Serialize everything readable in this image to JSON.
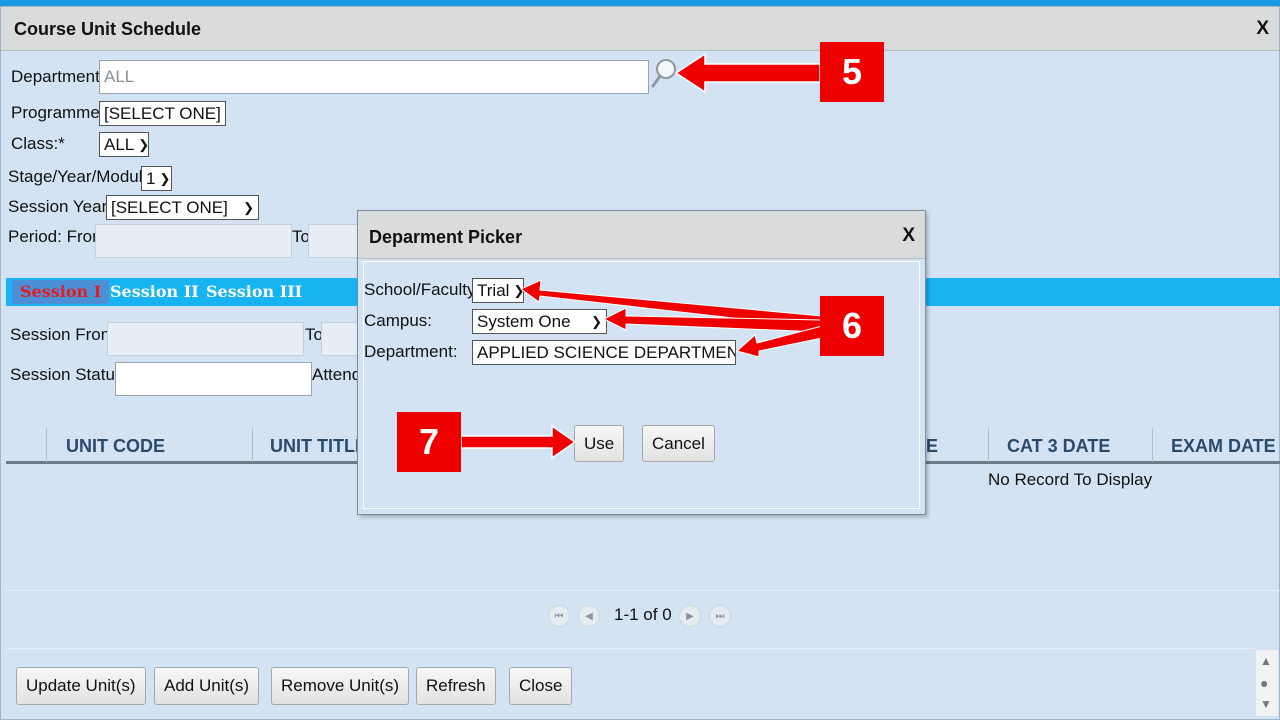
{
  "window": {
    "title": "Course Unit Schedule",
    "close": "X"
  },
  "form": {
    "department_label": "Department:",
    "department_value": "ALL",
    "programme_label": "Programme:",
    "programme_value": "[SELECT ONE]",
    "class_label": "Class:*",
    "class_value": "ALL",
    "stage_label": "Stage/Year/Module:",
    "stage_value": "1",
    "session_year_label": "Session Year:*",
    "session_year_value": "[SELECT ONE]",
    "period_from_label": "Period: From",
    "period_to_label": "To"
  },
  "tabs": [
    "Session I",
    "Session II",
    "Session III"
  ],
  "session": {
    "from_label": "Session From:",
    "to_label": "To",
    "status_label": "Session Status:",
    "attendance_label": "Attenda"
  },
  "grid": {
    "columns": [
      "UNIT CODE",
      "UNIT TITLE",
      "E",
      "CAT 3 DATE",
      "EXAM DATE"
    ],
    "empty_message": "No Record To Display"
  },
  "pager": {
    "info": "1-1 of 0"
  },
  "buttons": {
    "update": "Update Unit(s)",
    "add": "Add Unit(s)",
    "remove": "Remove Unit(s)",
    "refresh": "Refresh",
    "close": "Close"
  },
  "dialog": {
    "title": "Deparment Picker",
    "close": "X",
    "school_label": "School/Faculty:",
    "school_value": "Trial",
    "campus_label": "Campus:",
    "campus_value": "System One",
    "department_label": "Department:",
    "department_value": "APPLIED SCIENCE DEPARTMENT",
    "use_button": "Use",
    "cancel_button": "Cancel"
  },
  "annotations": {
    "step5": "5",
    "step6": "6",
    "step7": "7"
  },
  "colors": {
    "tab_bar": "#18b4f2",
    "active_tab_text": "#e81b1b",
    "annotation": "#ee0000",
    "panel": "#d4e3f3"
  }
}
